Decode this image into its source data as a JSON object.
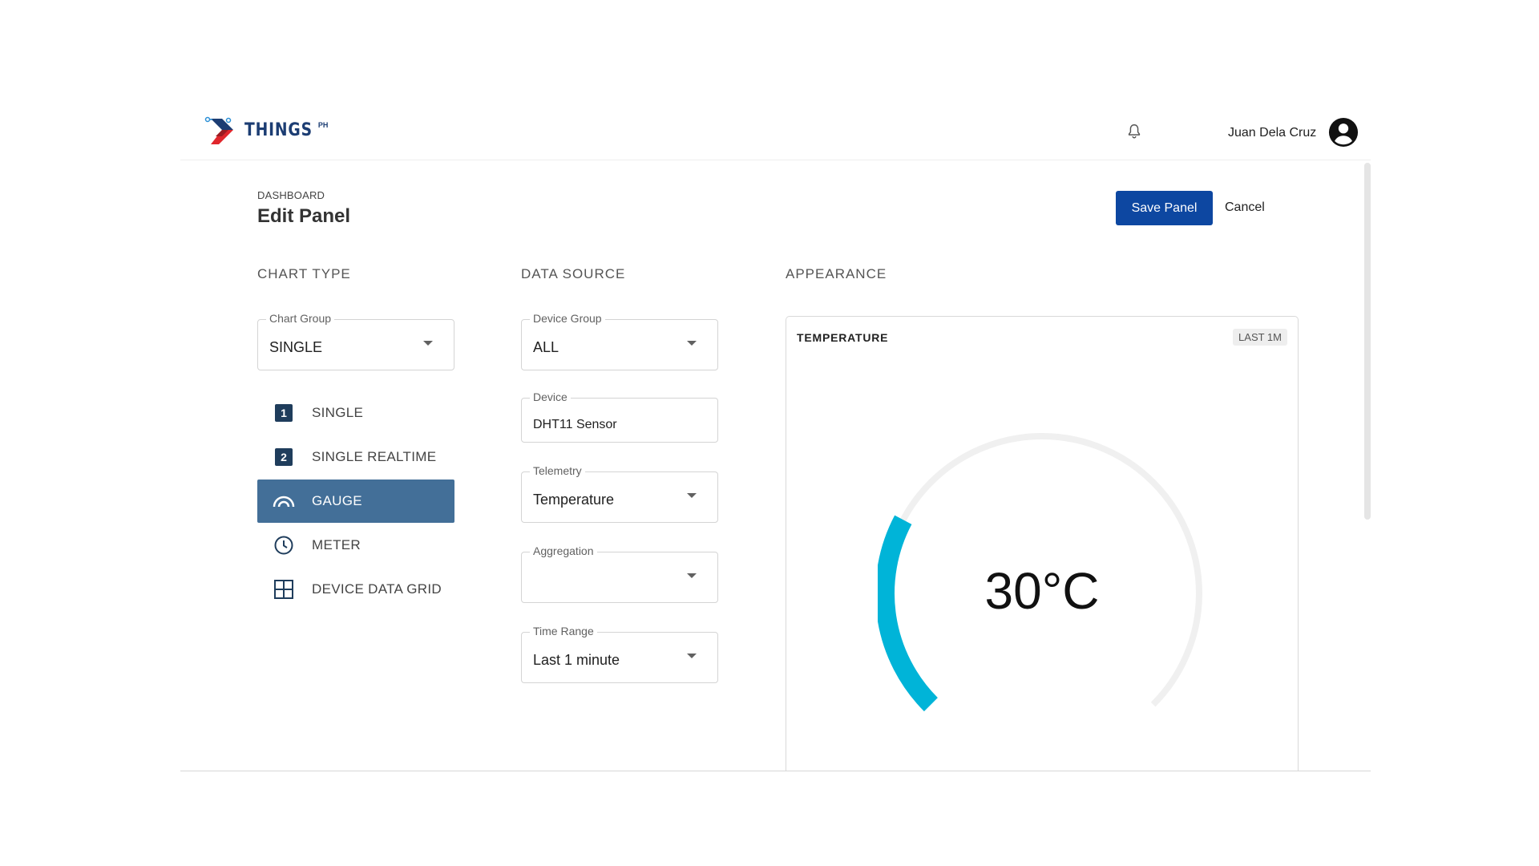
{
  "header": {
    "logo_text": "THINGS",
    "logo_sup": "PH",
    "user_name": "Juan Dela Cruz"
  },
  "page": {
    "breadcrumb": "DASHBOARD",
    "title": "Edit Panel",
    "save_label": "Save Panel",
    "cancel_label": "Cancel"
  },
  "sections": {
    "chart_type": "CHART TYPE",
    "data_source": "DATA SOURCE",
    "appearance": "APPEARANCE"
  },
  "chart_type": {
    "group_label": "Chart Group",
    "group_value": "SINGLE",
    "items": [
      {
        "label": "SINGLE",
        "icon": "number-1-icon",
        "active": false
      },
      {
        "label": "SINGLE REALTIME",
        "icon": "number-2-icon",
        "active": false
      },
      {
        "label": "GAUGE",
        "icon": "gauge-icon",
        "active": true
      },
      {
        "label": "METER",
        "icon": "clock-icon",
        "active": false
      },
      {
        "label": "DEVICE DATA GRID",
        "icon": "grid-icon",
        "active": false
      }
    ],
    "num1": "1",
    "num2": "2"
  },
  "data_source": {
    "device_group": {
      "label": "Device Group",
      "value": "ALL"
    },
    "device": {
      "label": "Device",
      "value": "DHT11 Sensor"
    },
    "telemetry": {
      "label": "Telemetry",
      "value": "Temperature"
    },
    "aggregation": {
      "label": "Aggregation",
      "value": ""
    },
    "time_range": {
      "label": "Time Range",
      "value": "Last 1 minute"
    }
  },
  "preview": {
    "title": "TEMPERATURE",
    "badge": "LAST 1M",
    "value_text": "30°C",
    "gauge_fill_fraction": 0.27,
    "colors": {
      "fill": "#00b4d8",
      "track": "#f0f0f0"
    }
  },
  "colors": {
    "primary": "#0d47a1",
    "active_item": "#436f98"
  }
}
